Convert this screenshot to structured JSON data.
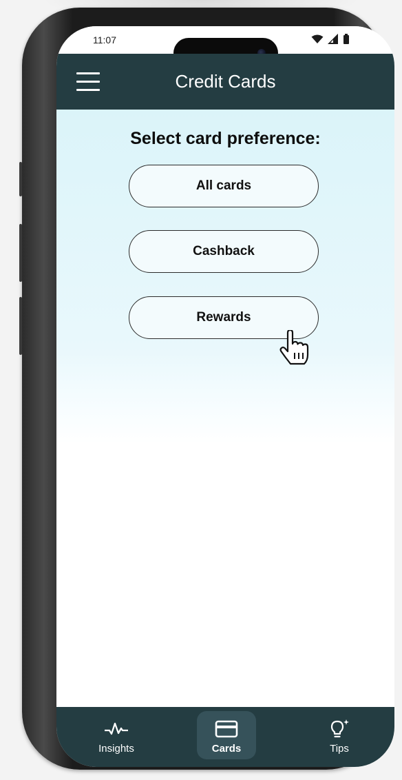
{
  "status_bar": {
    "time": "11:07",
    "icons": [
      "wifi-icon",
      "signal-icon",
      "battery-icon"
    ]
  },
  "app_bar": {
    "title": "Credit Cards",
    "menu_icon": "hamburger-menu-icon"
  },
  "content": {
    "prompt": "Select card preference:",
    "options": [
      {
        "label": "All cards"
      },
      {
        "label": "Cashback"
      },
      {
        "label": "Rewards"
      }
    ]
  },
  "bottom_nav": {
    "items": [
      {
        "label": "Insights",
        "icon": "activity-pulse-icon",
        "active": false
      },
      {
        "label": "Cards",
        "icon": "credit-card-icon",
        "active": true
      },
      {
        "label": "Tips",
        "icon": "lightbulb-sparkle-icon",
        "active": false
      }
    ]
  },
  "colors": {
    "header_bg": "#243d42",
    "nav_active_bg": "#36525a",
    "content_top": "#dbf4f9",
    "button_bg": "#f3fbfd",
    "button_border": "#2a2a2a"
  }
}
